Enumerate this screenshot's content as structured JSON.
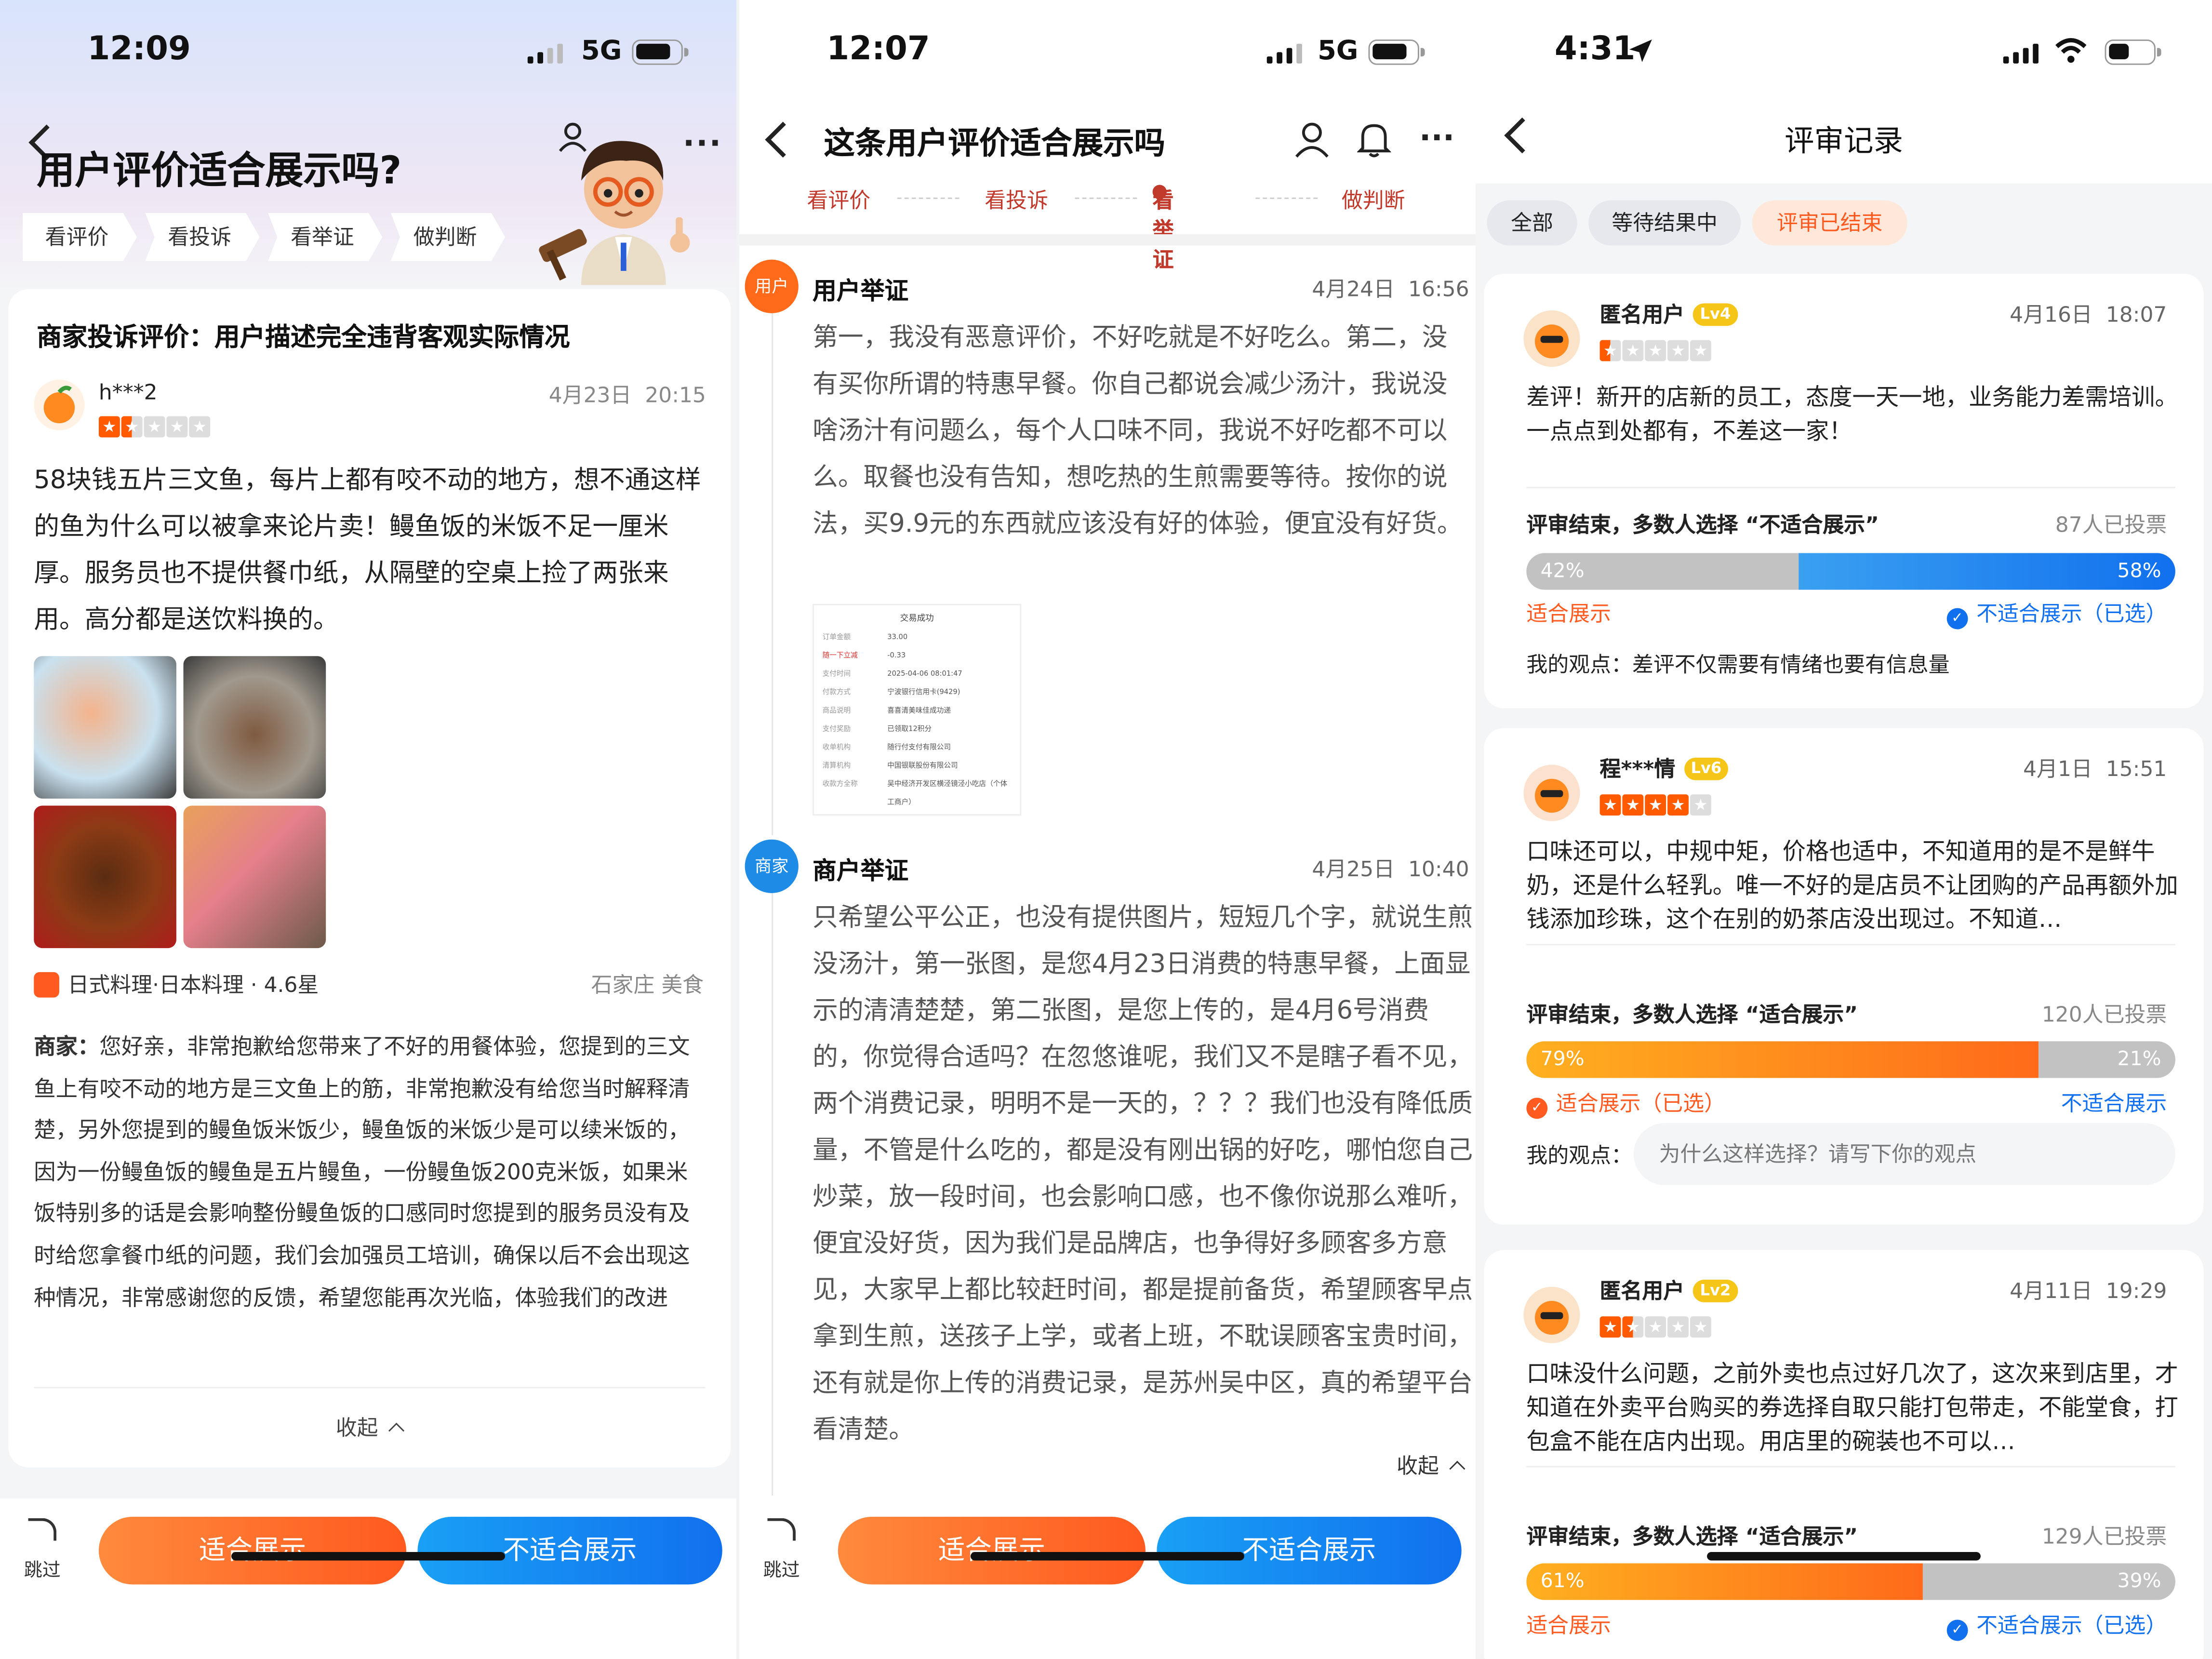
{
  "phone1": {
    "status": {
      "time": "12:09",
      "network": "5G"
    },
    "title": "用户评价适合展示吗?",
    "steps": [
      "看评价",
      "看投诉",
      "看举证",
      "做判断"
    ],
    "complaint_title": "商家投诉评价：用户描述完全违背客观实际情况",
    "reviewer": {
      "name": "h***2",
      "date": "4月23日",
      "time": "20:15",
      "rating": 1.5
    },
    "review_text": "58块钱五片三文鱼，每片上都有咬不动的地方，想不通这样的鱼为什么可以被拿来论片卖！鳗鱼饭的米饭不足一厘米厚。服务员也不提供餐巾纸，从隔壁的空桌上捡了两张来用。高分都是送饮料换的。",
    "shop": {
      "category": "日式料理·日本料理 · 4.6星",
      "location": "石家庄 美食"
    },
    "merchant_label": "商家：",
    "merchant_reply": "您好亲，非常抱歉给您带来了不好的用餐体验，您提到的三文鱼上有咬不动的地方是三文鱼上的筋，非常抱歉没有给您当时解释清楚，另外您提到的鳗鱼饭米饭少，鳗鱼饭的米饭少是可以续米饭的，因为一份鳗鱼饭的鳗鱼是五片鳗鱼，一份鳗鱼饭200克米饭，如果米饭特别多的话是会影响整份鳗鱼饭的口感同时您提到的服务员没有及时给您拿餐巾纸的问题，我们会加强员工培训，确保以后不会出现这种情况，非常感谢您的反馈，希望您能再次光临，体验我们的改进",
    "collapse": "收起",
    "skip": "跳过",
    "btn_suitable": "适合展示",
    "btn_unsuitable": "不适合展示"
  },
  "phone2": {
    "status": {
      "time": "12:07",
      "network": "5G"
    },
    "title": "这条用户评价适合展示吗",
    "tabs": [
      "看评价",
      "看投诉",
      "看举证",
      "做判断"
    ],
    "user_badge": "用户",
    "user_head": "用户举证",
    "user_date": "4月24日",
    "user_time": "16:56",
    "user_text": "第一，我没有恶意评价，不好吃就是不好吃么。第二，没有买你所谓的特惠早餐。你自己都说会减少汤汁，我说没啥汤汁有问题么，每个人口味不同，我说不好吃都不可以么。取餐也没有告知，想吃热的生煎需要等待。按你的说法，买9.9元的东西就应该没有好的体验，便宜没有好货。",
    "receipt_title": "交易成功",
    "receipt_rows": [
      [
        "订单金额",
        "33.00"
      ],
      [
        "随一下立减",
        "-0.33"
      ],
      [
        "支付时间",
        "2025-04-06 08:01:47"
      ],
      [
        "付款方式",
        "宁波银行信用卡(9429)"
      ],
      [
        "商品说明",
        "喜喜清美味佳成功递"
      ],
      [
        "支付奖励",
        "已领取12积分"
      ],
      [
        "收单机构",
        "随行付支付有限公司"
      ],
      [
        "清算机构",
        "中国银联股份有限公司"
      ],
      [
        "收款方全称",
        "吴中经济开发区横泾镜泾小吃店（个体工商户）"
      ],
      [
        "服务费用",
        ""
      ]
    ],
    "merchant_badge": "商家",
    "merchant_head": "商户举证",
    "merchant_date": "4月25日",
    "merchant_time": "10:40",
    "merchant_text": "只希望公平公正，也没有提供图片，短短几个字，就说生煎没汤汁，第一张图，是您4月23日消费的特惠早餐，上面显示的清清楚楚，第二张图，是您上传的，是4月6号消费的，你觉得合适吗？在忽悠谁呢，我们又不是瞎子看不见，两个消费记录，明明不是一天的，？？？我们也没有降低质量，不管是什么吃的，都是没有刚出锅的好吃，哪怕您自己炒菜，放一段时间，也会影响口感，也不像你说那么难听，便宜没好货，因为我们是品牌店，也争得好多顾客多方意见，大家早上都比较赶时间，都是提前备货，希望顾客早点拿到生煎，送孩子上学，或者上班，不耽误顾客宝贵时间，还有就是你上传的消费记录，是苏州吴中区，真的希望平台看清楚。",
    "collapse": "收起",
    "skip": "跳过",
    "btn_suitable": "适合展示",
    "btn_unsuitable": "不适合展示"
  },
  "phone3": {
    "status": {
      "time": "4:31"
    },
    "title": "评审记录",
    "filters": [
      "全部",
      "等待结果中",
      "评审已结束"
    ],
    "records": [
      {
        "user": "匿名用户",
        "level": "Lv4",
        "date": "4月16日",
        "time": "18:07",
        "rating": 0.5,
        "text": "差评！新开的店新的员工，态度一天一地，业务能力差需培训。一点点到处都有，不差这一家！",
        "result": "评审结束，多数人选择 “不适合展示”",
        "votes": "87人已投票",
        "left_pct": "42%",
        "right_pct": "58%",
        "left_frac": 0.42,
        "left_label": "适合展示",
        "right_label": "不适合展示（已选）",
        "opinion_label": "我的观点：",
        "opinion": "差评不仅需要有情绪也要有信息量"
      },
      {
        "user": "程***情",
        "level": "Lv6",
        "date": "4月1日",
        "time": "15:51",
        "rating": 4,
        "text": "口味还可以，中规中矩，价格也适中，不知道用的是不是鲜牛奶，还是什么轻乳。唯一不好的是店员不让团购的产品再额外加钱添加珍珠，这个在别的奶茶店没出现过。不知道…",
        "result": "评审结束，多数人选择 “适合展示”",
        "votes": "120人已投票",
        "left_pct": "79%",
        "right_pct": "21%",
        "left_frac": 0.79,
        "left_label": "适合展示（已选）",
        "right_label": "不适合展示",
        "opinion_label": "我的观点：",
        "opinion_placeholder": "为什么这样选择？请写下你的观点"
      },
      {
        "user": "匿名用户",
        "level": "Lv2",
        "date": "4月11日",
        "time": "19:29",
        "rating": 1.5,
        "text": "口味没什么问题，之前外卖也点过好几次了，这次来到店里，才知道在外卖平台购买的券选择自取只能打包带走，不能堂食，打包盒不能在店内出现。用店里的碗装也不可以…",
        "result": "评审结束，多数人选择 “适合展示”",
        "votes": "129人已投票",
        "left_pct": "61%",
        "right_pct": "39%",
        "left_frac": 0.61,
        "left_label": "适合展示",
        "right_label": "不适合展示（已选）"
      }
    ]
  },
  "colors": {
    "orange": "#ff5a1f",
    "blue": "#1170ee",
    "red_step": "#c0392b",
    "level": "#f5c518"
  }
}
